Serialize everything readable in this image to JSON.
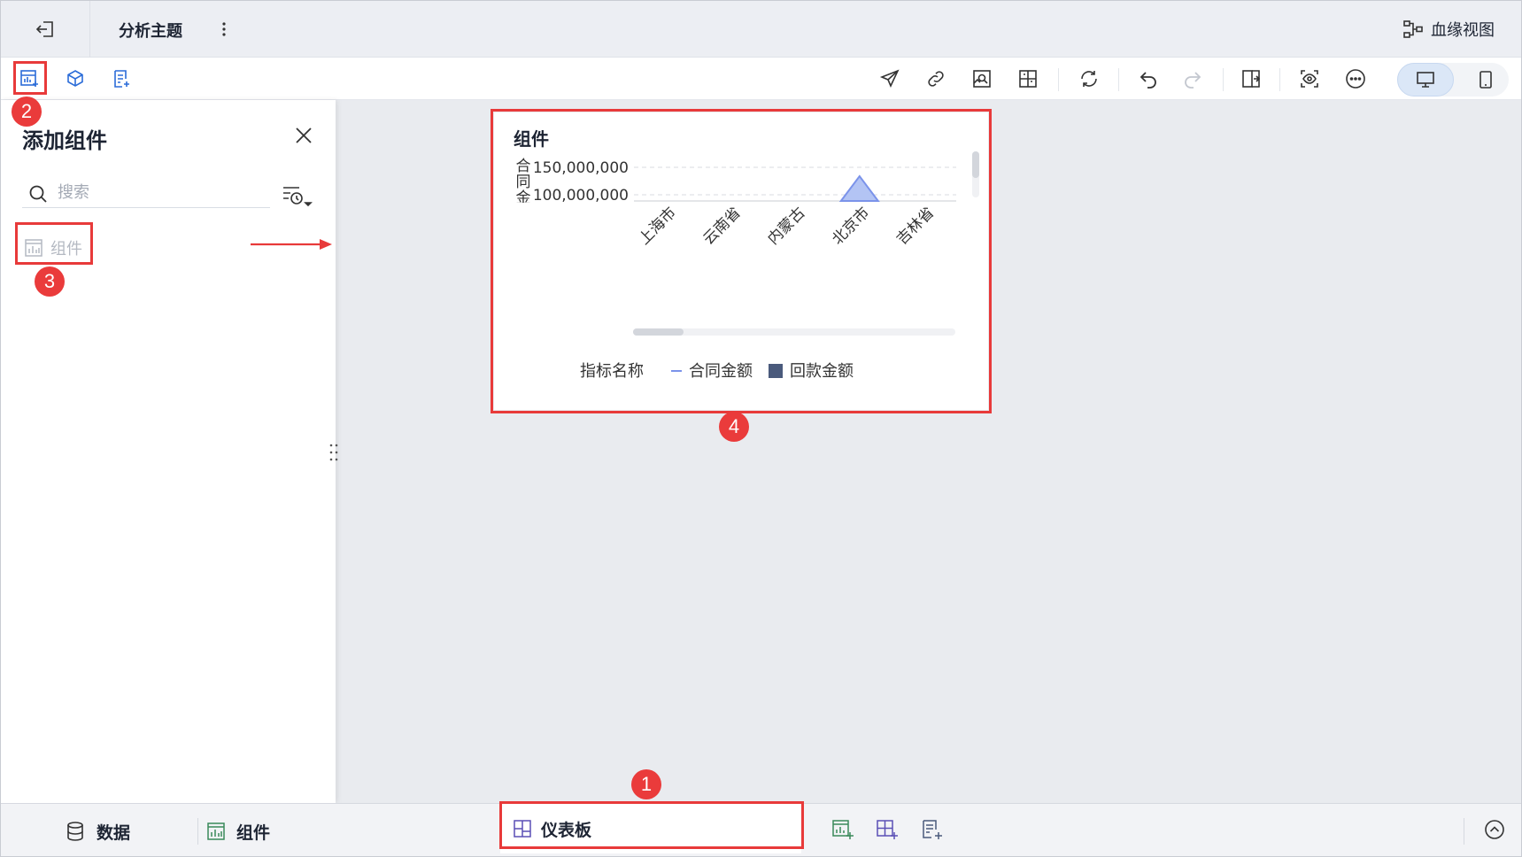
{
  "header": {
    "title": "分析主题",
    "lineage_label": "血缘视图"
  },
  "panel": {
    "title": "添加组件",
    "search_placeholder": "搜索",
    "items": [
      {
        "label": "组件"
      }
    ]
  },
  "widget": {
    "title": "组件",
    "ylabel": "合同金额",
    "yticks": [
      "150,000,000",
      "100,000,000"
    ],
    "categories": [
      "上海市",
      "云南省",
      "内蒙古",
      "北京市",
      "吉林省"
    ],
    "legend_title": "指标名称",
    "legend": [
      {
        "name": "合同金额",
        "symbol": "line",
        "color": "#7b93ea"
      },
      {
        "name": "回款金额",
        "symbol": "square",
        "color": "#4a5a7c"
      }
    ]
  },
  "bottom": {
    "data_label": "数据",
    "component_label": "组件",
    "dashboard_label": "仪表板"
  },
  "annotations": [
    "1",
    "2",
    "3",
    "4"
  ],
  "colors": {
    "accent": "#2b6cd8",
    "highlight": "#e83a3a",
    "area_fill": "#b3c4f4",
    "area_stroke": "#7b93ea"
  }
}
